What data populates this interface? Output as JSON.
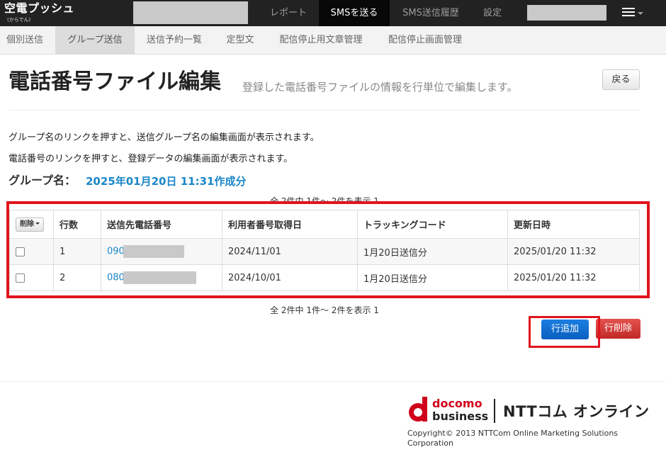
{
  "navbar": {
    "brand": "空電プッシュ",
    "brand_sub": "(からでん)",
    "items": [
      "レポート",
      "SMSを送る",
      "SMS送信履歴",
      "設定"
    ]
  },
  "subnav": {
    "items": [
      "個別送信",
      "グループ送信",
      "送信予約一覧",
      "定型文",
      "配信停止用文章管理",
      "配信停止画面管理"
    ]
  },
  "page": {
    "title": "電話番号ファイル編集",
    "subtitle": "登録した電話番号ファイルの情報を行単位で編集します。",
    "back_label": "戻る",
    "info1": "グループ名のリンクを押すと、送信グループ名の編集画面が表示されます。",
    "info2": "電話番号のリンクを押すと、登録データの編集画面が表示されます。",
    "group_label": "グループ名：",
    "group_value": "2025年01月20日 11:31作成分",
    "pager": "全 2件中  1件～ 2件を表示  1"
  },
  "table": {
    "delete_menu_label": "削除",
    "headers": [
      "行数",
      "送信先電話番号",
      "利用者番号取得日",
      "トラッキングコード",
      "更新日時"
    ],
    "rows": [
      {
        "no": "1",
        "phone": "090",
        "acquired": "2024/11/01",
        "tracking": "1月20日送信分",
        "updated": "2025/01/20 11:32"
      },
      {
        "no": "2",
        "phone": "080",
        "acquired": "2024/10/01",
        "tracking": "1月20日送信分",
        "updated": "2025/01/20 11:32"
      }
    ]
  },
  "actions": {
    "add_label": "行追加",
    "delete_label": "行削除"
  },
  "footer": {
    "docomo": "docomo",
    "business": "business",
    "ntt": "NTTコム オンライン",
    "copyright": "Copyright© 2013 NTTCom Online Marketing Solutions Corporation"
  },
  "colors": {
    "accent_link": "#1a87c9",
    "highlight": "#e0141e",
    "primary_button": "#0a6fd6",
    "danger_button": "#d33c38"
  }
}
